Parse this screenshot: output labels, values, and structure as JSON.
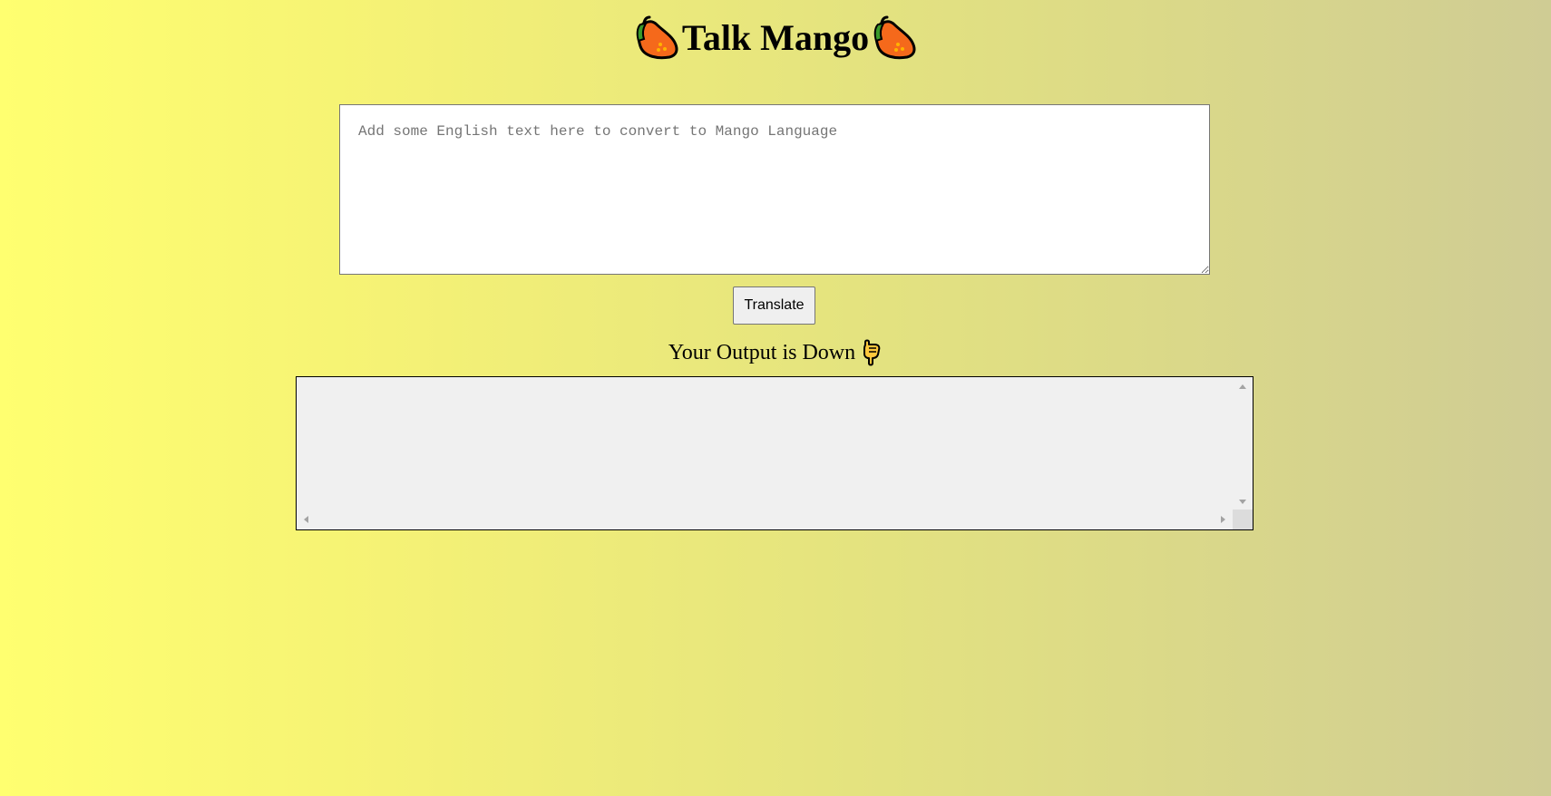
{
  "header": {
    "title": "Talk Mango",
    "left_icon": "mango-icon",
    "right_icon": "mango-icon"
  },
  "input": {
    "placeholder": "Add some English text here to convert to Mango Language",
    "value": ""
  },
  "translate_button": {
    "label": "Translate"
  },
  "output": {
    "heading": "Your Output is Down",
    "heading_icon": "pointing-down-icon",
    "text": ""
  },
  "colors": {
    "background_start": "#ffff70",
    "background_end": "#cfcc94",
    "mango_orange": "#f5691b",
    "mango_leaf": "#3a9a2a",
    "output_bg": "#f0f0f0"
  }
}
